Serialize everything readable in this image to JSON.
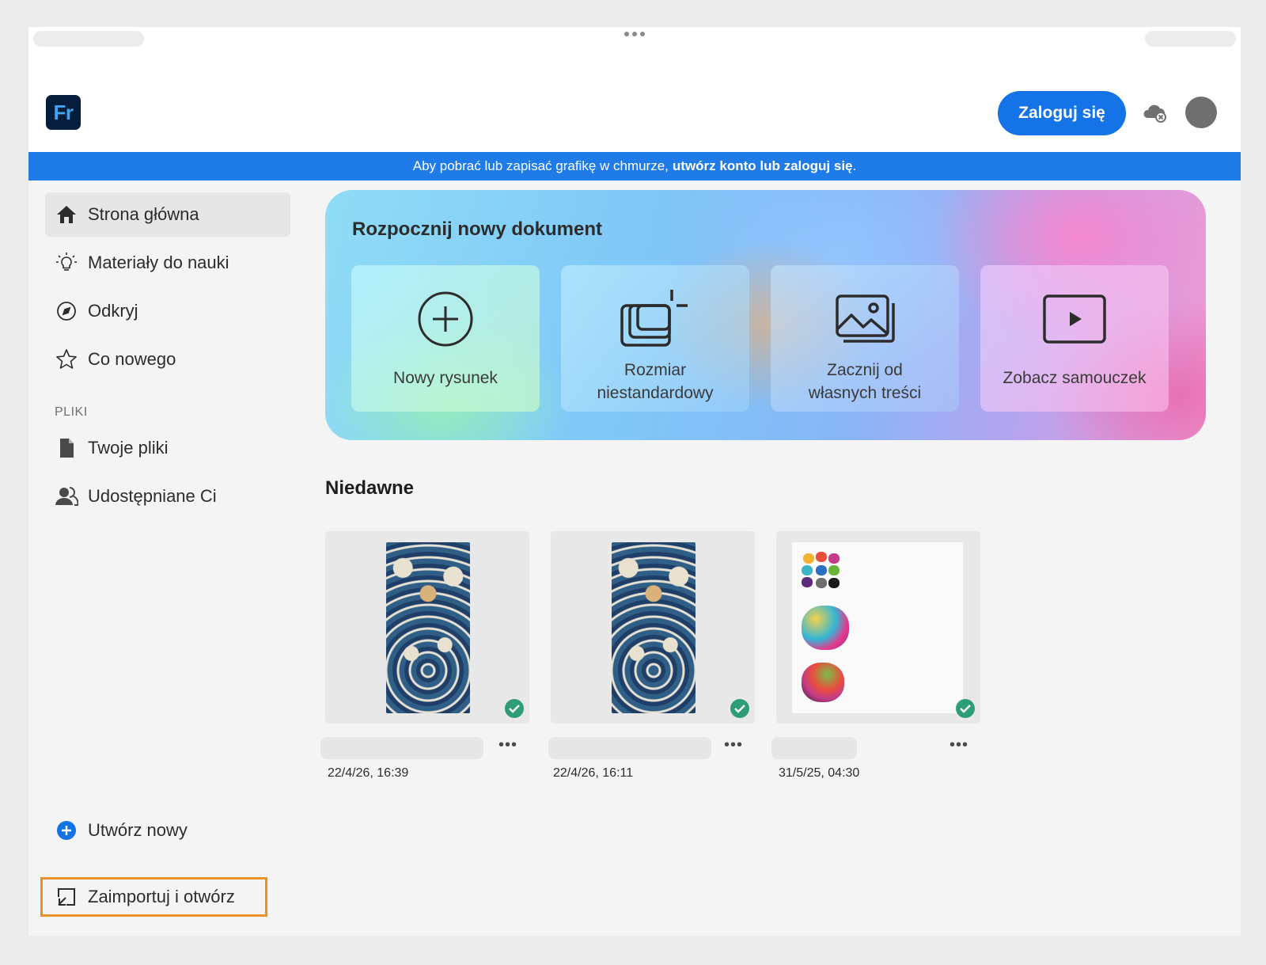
{
  "app": {
    "logo_text": "Fr",
    "brand_color": "#1473e6"
  },
  "header": {
    "signin_label": "Zaloguj się",
    "cloud_icon": "cloud-offline-icon"
  },
  "banner": {
    "text": "Aby pobrać lub zapisać grafikę w chmurze,",
    "link": "utwórz konto lub zaloguj się",
    "suffix": "."
  },
  "sidebar": {
    "items": [
      {
        "label": "Strona główna",
        "icon": "home-icon",
        "active": true
      },
      {
        "label": "Materiały do nauki",
        "icon": "lightbulb-icon"
      },
      {
        "label": "Odkryj",
        "icon": "compass-icon"
      },
      {
        "label": "Co nowego",
        "icon": "star-icon"
      }
    ],
    "files_section": "PLIKI",
    "file_items": [
      {
        "label": "Twoje pliki",
        "icon": "file-icon"
      },
      {
        "label": "Udostępniane Ci",
        "icon": "people-icon"
      }
    ],
    "bottom_items": [
      {
        "label": "Utwórz nowy",
        "icon": "plus-circle-icon"
      },
      {
        "label": "Zaimportuj i otwórz",
        "icon": "import-icon"
      }
    ]
  },
  "hero": {
    "title": "Rozpocznij nowy dokument",
    "cards": [
      {
        "label": "Nowy rysunek",
        "icon": "plus-circle-icon"
      },
      {
        "label": "Rozmiar\nniestandardowy",
        "icon": "custom-size-icon"
      },
      {
        "label": "Zacznij od\nwłasnych treści",
        "icon": "image-icon"
      },
      {
        "label": "Zobacz samouczek",
        "icon": "play-icon"
      }
    ]
  },
  "recent": {
    "title": "Niedawne",
    "items": [
      {
        "date": "22/4/26, 16:39",
        "synced": true
      },
      {
        "date": "22/4/26, 16:11",
        "synced": true
      },
      {
        "date": "31/5/25, 04:30",
        "synced": true
      }
    ]
  }
}
